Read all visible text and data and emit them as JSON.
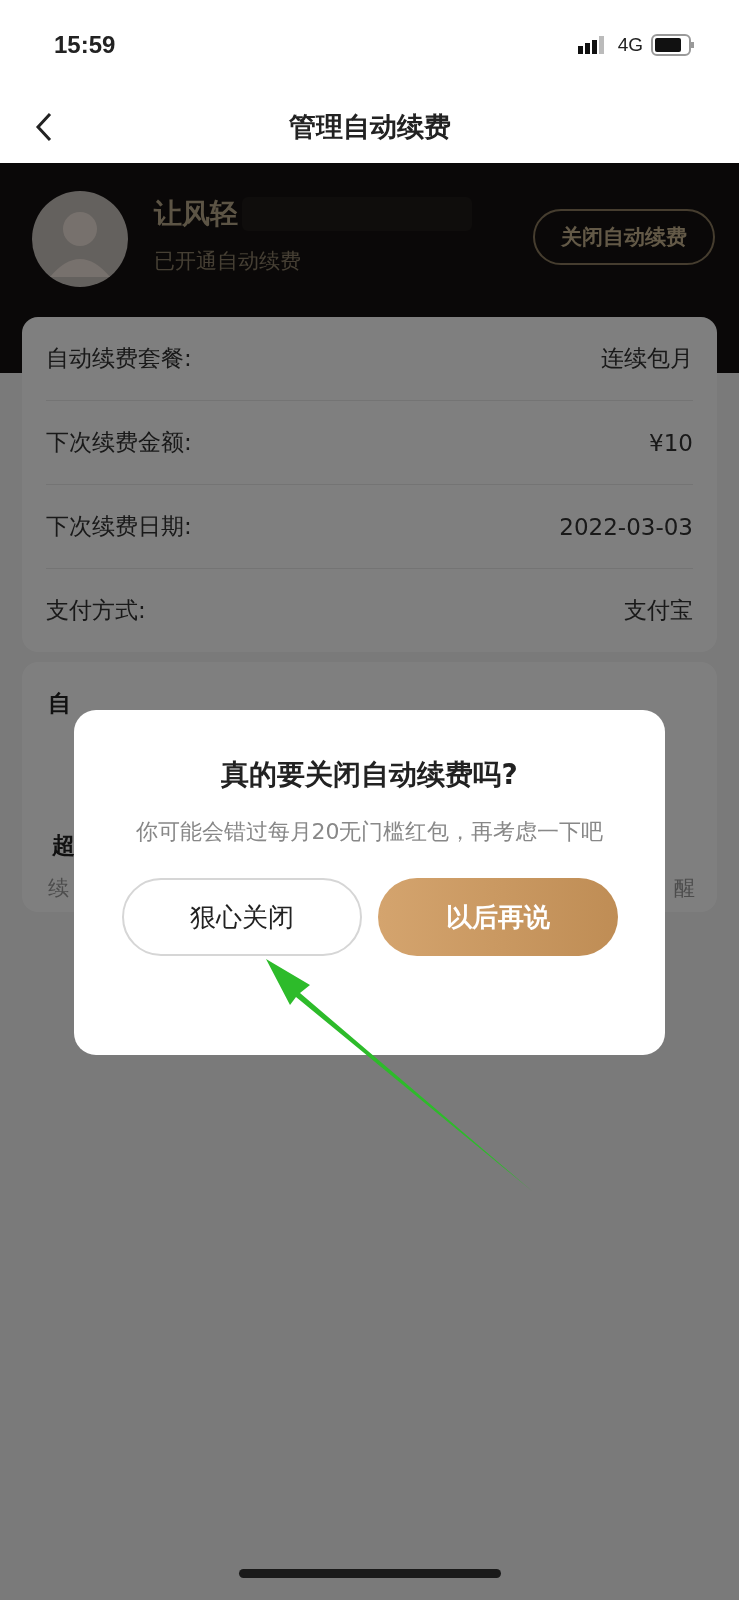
{
  "status_bar": {
    "time": "15:59",
    "network": "4G"
  },
  "nav": {
    "title": "管理自动续费"
  },
  "header": {
    "name": "让风轻",
    "status": "已开通自动续费",
    "button": "关闭自动续费"
  },
  "details": [
    {
      "label": "自动续费套餐:",
      "value": "连续包月"
    },
    {
      "label": "下次续费金额:",
      "value": "¥10"
    },
    {
      "label": "下次续费日期:",
      "value": "2022-03-03"
    },
    {
      "label": "支付方式:",
      "value": "支付宝"
    }
  ],
  "hidden_card": {
    "title": "自",
    "item": "超",
    "note_left": "续",
    "note_right": "醒"
  },
  "dialog": {
    "title": "真的要关闭自动续费吗?",
    "message": "你可能会错过每月20无门槛红包，再考虑一下吧",
    "buttons": [
      {
        "label": "狠心关闭",
        "kind": "secondary"
      },
      {
        "label": "以后再说",
        "kind": "primary"
      }
    ]
  }
}
